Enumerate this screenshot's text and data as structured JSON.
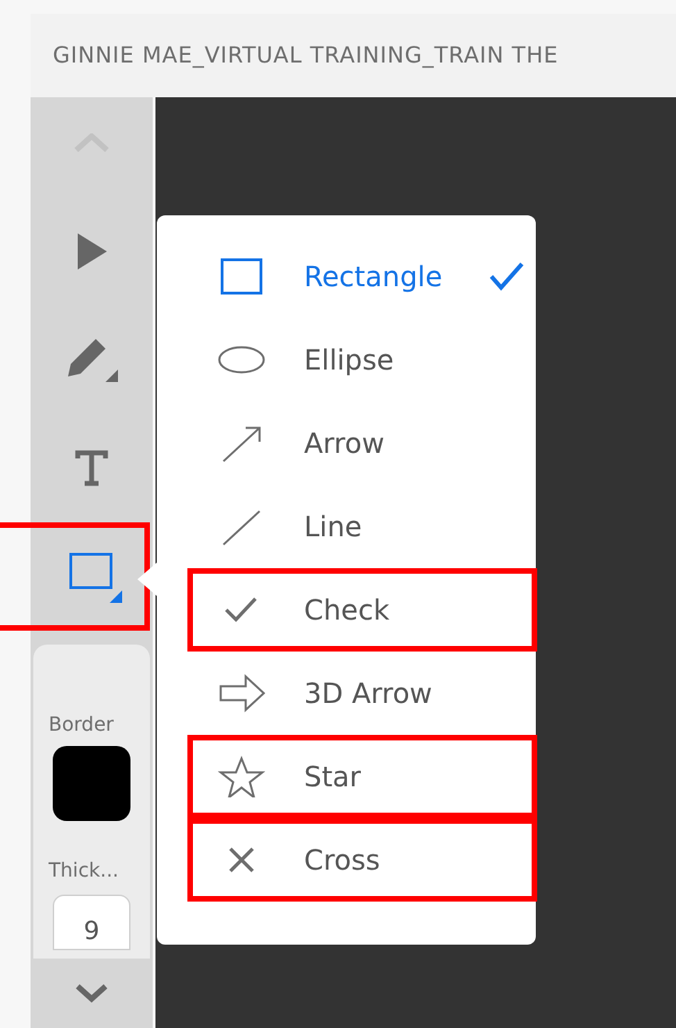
{
  "window": {
    "title": "GINNIE MAE_VIRTUAL TRAINING_TRAIN THE"
  },
  "tools": [
    {
      "kind": "select",
      "selected": false,
      "highlighted": false
    },
    {
      "kind": "pen",
      "selected": false,
      "highlighted": false
    },
    {
      "kind": "text",
      "selected": false,
      "highlighted": false
    },
    {
      "kind": "shape",
      "selected": true,
      "highlighted": true
    }
  ],
  "properties": {
    "border_label": "Border",
    "thickness_label": "Thick...",
    "thickness_value": "9"
  },
  "shape_menu": [
    {
      "kind": "rectangle",
      "label": "Rectangle",
      "selected": true,
      "highlighted": false
    },
    {
      "kind": "ellipse",
      "label": "Ellipse",
      "selected": false,
      "highlighted": false
    },
    {
      "kind": "arrow",
      "label": "Arrow",
      "selected": false,
      "highlighted": false
    },
    {
      "kind": "line",
      "label": "Line",
      "selected": false,
      "highlighted": false
    },
    {
      "kind": "check",
      "label": "Check",
      "selected": false,
      "highlighted": true
    },
    {
      "kind": "arrow3d",
      "label": "3D Arrow",
      "selected": false,
      "highlighted": false
    },
    {
      "kind": "star",
      "label": "Star",
      "selected": false,
      "highlighted": true
    },
    {
      "kind": "cross",
      "label": "Cross",
      "selected": false,
      "highlighted": true
    }
  ]
}
